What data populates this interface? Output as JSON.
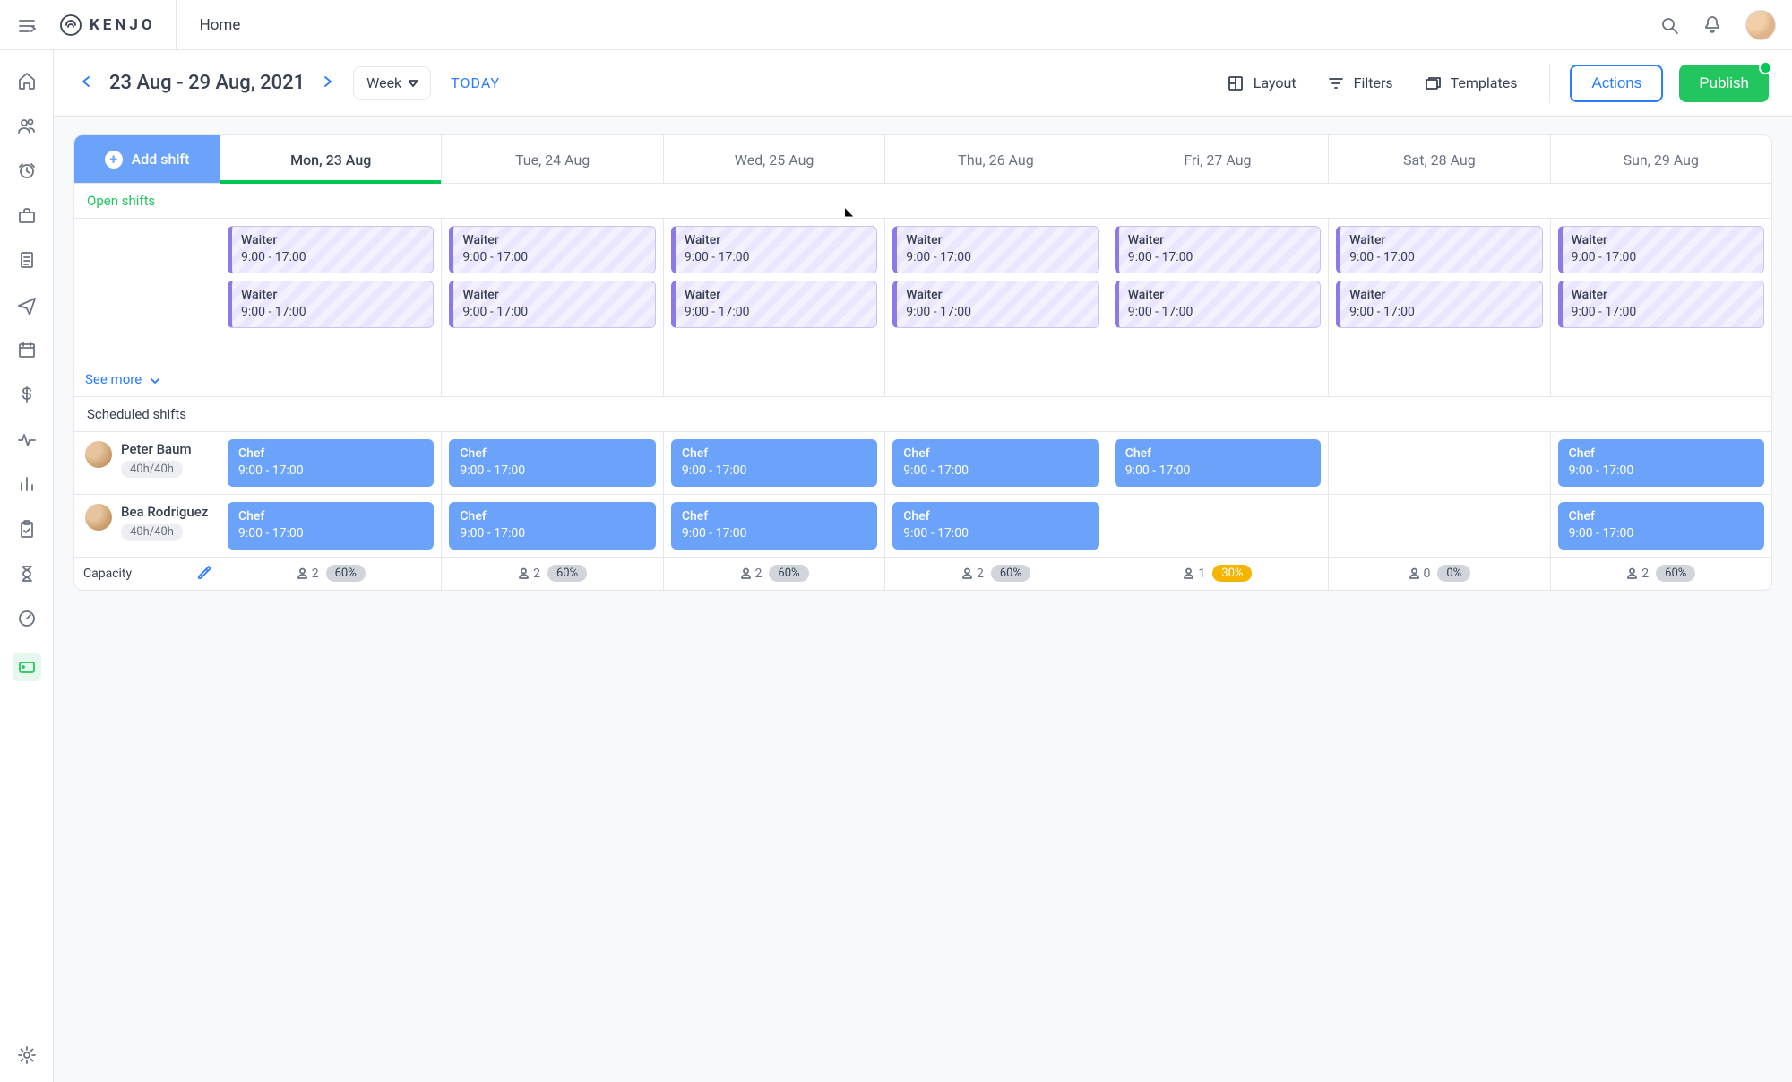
{
  "brand": "KENJO",
  "breadcrumb": "Home",
  "toolbar": {
    "date_range": "23 Aug - 29 Aug, 2021",
    "view_select": "Week",
    "today": "TODAY",
    "layout": "Layout",
    "filters": "Filters",
    "templates": "Templates",
    "actions": "Actions",
    "publish": "Publish"
  },
  "add_shift_label": "Add shift",
  "days": [
    "Mon, 23 Aug",
    "Tue, 24 Aug",
    "Wed, 25 Aug",
    "Thu, 26 Aug",
    "Fri, 27 Aug",
    "Sat, 28 Aug",
    "Sun, 29 Aug"
  ],
  "sections": {
    "open": "Open shifts",
    "scheduled": "Scheduled shifts",
    "see_more": "See more"
  },
  "open_shifts": {
    "role": "Waiter",
    "time": "9:00 - 17:00",
    "per_day_count": [
      2,
      2,
      2,
      2,
      2,
      2,
      2
    ]
  },
  "employees": [
    {
      "name": "Peter Baum",
      "hours": "40h/40h",
      "shifts": [
        {
          "role": "Chef",
          "time": "9:00 - 17:00"
        },
        {
          "role": "Chef",
          "time": "9:00 - 17:00"
        },
        {
          "role": "Chef",
          "time": "9:00 - 17:00"
        },
        {
          "role": "Chef",
          "time": "9:00 - 17:00"
        },
        {
          "role": "Chef",
          "time": "9:00 - 17:00"
        },
        null,
        {
          "role": "Chef",
          "time": "9:00 - 17:00"
        }
      ]
    },
    {
      "name": "Bea Rodriguez",
      "hours": "40h/40h",
      "shifts": [
        {
          "role": "Chef",
          "time": "9:00 - 17:00"
        },
        {
          "role": "Chef",
          "time": "9:00 - 17:00"
        },
        {
          "role": "Chef",
          "time": "9:00 - 17:00"
        },
        {
          "role": "Chef",
          "time": "9:00 - 17:00"
        },
        null,
        null,
        {
          "role": "Chef",
          "time": "9:00 - 17:00"
        }
      ]
    }
  ],
  "capacity": {
    "label": "Capacity",
    "days": [
      {
        "count": 2,
        "pct": "60%",
        "warn": false
      },
      {
        "count": 2,
        "pct": "60%",
        "warn": false
      },
      {
        "count": 2,
        "pct": "60%",
        "warn": false
      },
      {
        "count": 2,
        "pct": "60%",
        "warn": false
      },
      {
        "count": 1,
        "pct": "30%",
        "warn": true
      },
      {
        "count": 0,
        "pct": "0%",
        "warn": false
      },
      {
        "count": 2,
        "pct": "60%",
        "warn": false
      }
    ]
  }
}
